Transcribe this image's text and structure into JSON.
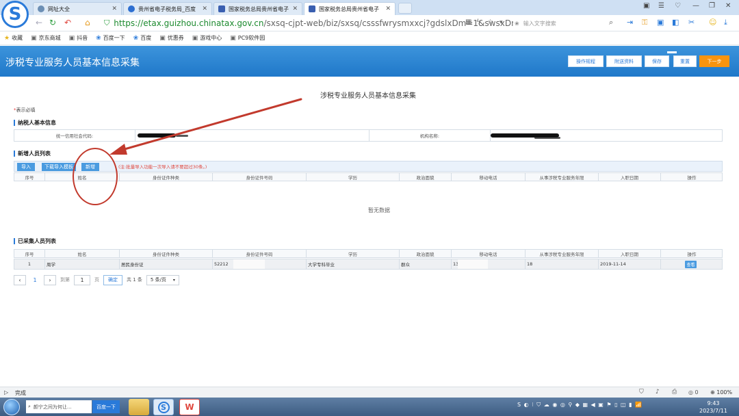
{
  "browser": {
    "tabs": [
      {
        "label": "网址大全",
        "icon_color": "#6c8fb5",
        "active": false
      },
      {
        "label": "贵州省电子税务局_百度",
        "icon_color": "#2d6fd1",
        "active": false
      },
      {
        "label": "国家税务总局贵州省电子",
        "icon_color": "#3a5fb0",
        "active": false
      },
      {
        "label": "国家税务总局贵州省电子",
        "icon_color": "#3a5fb0",
        "active": true
      }
    ],
    "tab_close": "✕",
    "url_domain": "https://etax.guizhou.chinatax.gov.cn",
    "url_path": "/sxsq-cjpt-web/biz/sxsq/csssfwrysmxxcj?gdslxDm=1&swsxDm=SX",
    "search_placeholder": "输入文字搜索",
    "bookmarks": [
      {
        "label": "收藏",
        "icon": "star-icon",
        "glyph": "★"
      },
      {
        "label": "京东商城",
        "icon": "page-icon",
        "glyph": "▣"
      },
      {
        "label": "抖音",
        "icon": "page-icon",
        "glyph": "▣"
      },
      {
        "label": "百度一下",
        "icon": "baidu-icon",
        "glyph": "❀"
      },
      {
        "label": "百度",
        "icon": "baidu-icon",
        "glyph": "❀"
      },
      {
        "label": "优惠券",
        "icon": "page-icon",
        "glyph": "▣"
      },
      {
        "label": "游戏中心",
        "icon": "page-icon",
        "glyph": "▣"
      },
      {
        "label": "PC9软件园",
        "icon": "page-icon",
        "glyph": "▣"
      }
    ]
  },
  "header": {
    "title": "涉税专业服务人员基本信息采集",
    "buttons": [
      "操作规程",
      "附送资料",
      "保存",
      "重置",
      "下一步"
    ]
  },
  "page": {
    "title": "涉税专业服务人员基本信息采集",
    "required_mark": "*",
    "required_note": "表示必填",
    "taxpayer_section": "纳税人基本信息",
    "credit_code_label": "统一信用社会代码:",
    "org_name_label": "机构名称:",
    "new_section": "新增人员列表",
    "btn_import": "导入",
    "btn_download": "下载导入模板",
    "btn_add": "新增",
    "import_note": "(注:批量导入功能一次导入请不要超过30条。)",
    "columns": [
      "序号",
      "姓名",
      "身份证件种类",
      "身份证件号码",
      "学历",
      "政治面貌",
      "移动电话",
      "从事涉税专业服务年限",
      "入职日期",
      "操作"
    ],
    "empty_text": "暂无数据",
    "collected_section": "已采集人员列表",
    "rows": [
      {
        "no": "1",
        "name": "周学",
        "id_type": "居民身份证",
        "id_no": "52212",
        "education": "大学专科毕业",
        "political": "群众",
        "phone": "13",
        "years": "18",
        "join_date": "2019-11-14",
        "action": "查看"
      }
    ],
    "pager": {
      "prev": "‹",
      "current": "1",
      "next": "›",
      "goto_label": "到第",
      "page_input": "1",
      "page_unit": "页",
      "confirm": "确定",
      "total": "共 1 条",
      "page_size": "5 条/页"
    }
  },
  "status": {
    "text": "完成",
    "zoom": "100%",
    "net_count": "0"
  },
  "taskbar": {
    "search_placeholder": "颜宁之间为何让...",
    "search_button": "百度一下",
    "time": "9:43",
    "date": "2023/7/11"
  },
  "colors": {
    "brand_blue": "#2a7ad9",
    "header_blue": "#1f78c9",
    "next_orange": "#f8940f",
    "annotation_red": "#c23a2d"
  }
}
